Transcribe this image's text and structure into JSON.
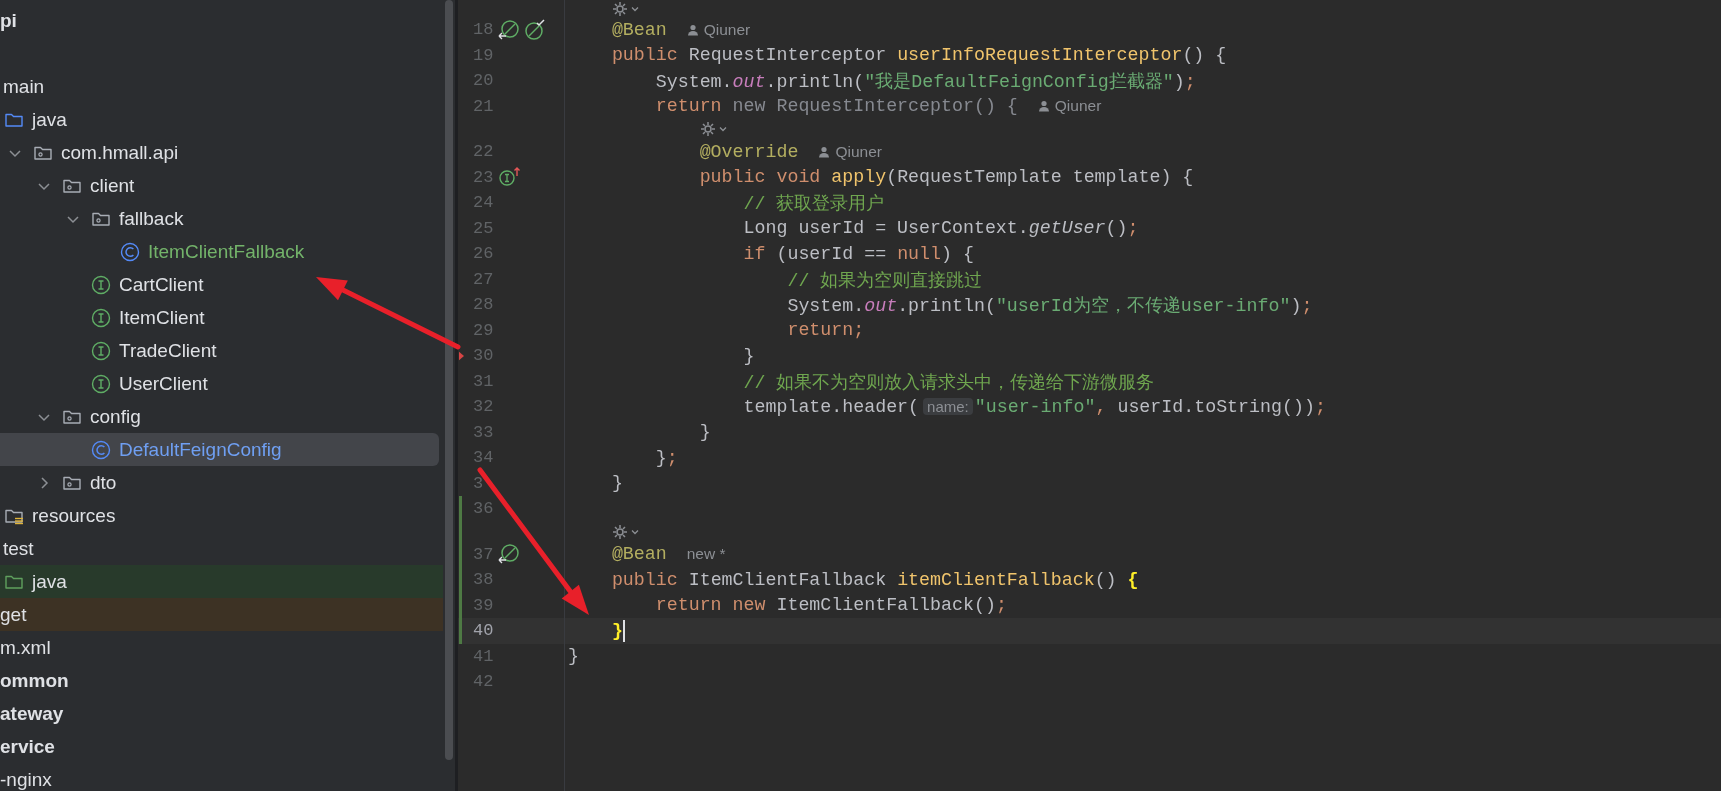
{
  "project_tree": [
    {
      "label": "pi",
      "kind": "module",
      "selected": false,
      "children": [
        {
          "children": [
            {
              "label": "main",
              "selected": false,
              "children": [
                {
                  "label": "java",
                  "kind": "source-folder",
                  "selected": false,
                  "children": [
                    {
                      "label": "com.hmall.api",
                      "kind": "package",
                      "expanded": true,
                      "selected": false,
                      "children": [
                        {
                          "label": "client",
                          "kind": "package",
                          "expanded": true,
                          "selected": false,
                          "children": [
                            {
                              "label": "fallback",
                              "kind": "package",
                              "expanded": true,
                              "selected": false,
                              "children": [
                                {
                                  "label": "ItemClientFallback",
                                  "kind": "class",
                                  "color": "#73b36a",
                                  "selected": false
                                }
                              ]
                            },
                            {
                              "label": "CartClient",
                              "kind": "interface",
                              "selected": false
                            },
                            {
                              "label": "ItemClient",
                              "kind": "interface",
                              "selected": false
                            },
                            {
                              "label": "TradeClient",
                              "kind": "interface",
                              "selected": false
                            },
                            {
                              "label": "UserClient",
                              "kind": "interface",
                              "selected": false
                            }
                          ]
                        },
                        {
                          "label": "config",
                          "kind": "package",
                          "expanded": true,
                          "selected": false,
                          "children": [
                            {
                              "label": "DefaultFeignConfig",
                              "kind": "class",
                              "color": "#6f9ff2",
                              "selected": true
                            }
                          ]
                        },
                        {
                          "label": "dto",
                          "kind": "package",
                          "expanded": false,
                          "selected": false
                        }
                      ]
                    }
                  ]
                },
                {
                  "label": "resources",
                  "kind": "resources-folder",
                  "selected": false
                }
              ]
            },
            {
              "label": "test",
              "selected": false,
              "children": [
                {
                  "label": "java",
                  "kind": "test-folder",
                  "selected": false
                }
              ]
            }
          ]
        },
        {
          "label": "get",
          "kind": "excluded",
          "selected": false
        },
        {
          "label": "m.xml",
          "kind": "item",
          "selected": false
        }
      ]
    },
    {
      "label": "ommon",
      "kind": "module",
      "selected": false
    },
    {
      "label": "ateway",
      "kind": "module",
      "selected": false
    },
    {
      "label": "ervice",
      "kind": "module",
      "selected": false
    },
    {
      "label": "-nginx",
      "kind": "item",
      "selected": false
    }
  ],
  "editor": {
    "rows": [
      {
        "number": "18",
        "current": false,
        "inlay": true,
        "gutter": [
          {
            "kind": "bean"
          },
          {
            "kind": "bean-check"
          }
        ],
        "author": "Qiuner",
        "tokens": [
          {
            "kind": "annotation",
            "text": "    @Bean"
          }
        ]
      },
      {
        "number": "19",
        "current": false,
        "tokens": [
          {
            "kind": "keyword",
            "text": "    public "
          },
          {
            "kind": "plain",
            "text": "RequestInterceptor "
          },
          {
            "kind": "decl",
            "text": "userInfoRequestInterceptor"
          },
          {
            "kind": "plain",
            "text": "() {"
          }
        ]
      },
      {
        "number": "20",
        "current": false,
        "tokens": [
          {
            "kind": "plain",
            "text": "        System."
          },
          {
            "kind": "field",
            "text": "out"
          },
          {
            "kind": "plain",
            "text": ".println("
          },
          {
            "kind": "string",
            "text": "\"我是DefaultFeignConfig拦截器\""
          },
          {
            "kind": "plain",
            "text": ")"
          },
          {
            "kind": "punct",
            "text": ";"
          }
        ]
      },
      {
        "number": "21",
        "current": false,
        "author": "Qiuner",
        "tokens": [
          {
            "kind": "keyword",
            "text": "        return "
          },
          {
            "kind": "muted",
            "text": "new RequestInterceptor() {"
          }
        ]
      },
      {
        "number": "22",
        "current": false,
        "inlay": true,
        "author": "Qiuner",
        "tokens": [
          {
            "kind": "annotation",
            "text": "            @Override"
          }
        ]
      },
      {
        "number": "23",
        "current": false,
        "gutter": [
          {
            "kind": "implements"
          }
        ],
        "tokens": [
          {
            "kind": "keyword",
            "text": "            public void "
          },
          {
            "kind": "decl",
            "text": "apply"
          },
          {
            "kind": "plain",
            "text": "(RequestTemplate template) {"
          }
        ]
      },
      {
        "number": "24",
        "current": false,
        "tokens": [
          {
            "kind": "comment",
            "text": "                // 获取登录用户"
          }
        ]
      },
      {
        "number": "25",
        "current": false,
        "tokens": [
          {
            "kind": "plain",
            "text": "                Long userId = UserContext."
          },
          {
            "kind": "call",
            "text": "getUser"
          },
          {
            "kind": "plain",
            "text": "()"
          },
          {
            "kind": "punct",
            "text": ";"
          }
        ]
      },
      {
        "number": "26",
        "current": false,
        "tokens": [
          {
            "kind": "keyword",
            "text": "                if "
          },
          {
            "kind": "plain",
            "text": "(userId == "
          },
          {
            "kind": "keyword",
            "text": "null"
          },
          {
            "kind": "plain",
            "text": ") {"
          }
        ]
      },
      {
        "number": "27",
        "current": false,
        "tokens": [
          {
            "kind": "comment",
            "text": "                    // 如果为空则直接跳过"
          }
        ]
      },
      {
        "number": "28",
        "current": false,
        "tokens": [
          {
            "kind": "plain",
            "text": "                    System."
          },
          {
            "kind": "field",
            "text": "out"
          },
          {
            "kind": "plain",
            "text": ".println("
          },
          {
            "kind": "string",
            "text": "\"userId为空，不传递user-info\""
          },
          {
            "kind": "plain",
            "text": ")"
          },
          {
            "kind": "punct",
            "text": ";"
          }
        ]
      },
      {
        "number": "29",
        "current": false,
        "tokens": [
          {
            "kind": "keyword",
            "text": "                    return"
          },
          {
            "kind": "punct",
            "text": ";"
          }
        ]
      },
      {
        "number": "30",
        "current": false,
        "change": {
          "kind": "deleted"
        },
        "tokens": [
          {
            "kind": "plain",
            "text": "                }"
          }
        ]
      },
      {
        "number": "31",
        "current": false,
        "tokens": [
          {
            "kind": "comment",
            "text": "                // 如果不为空则放入请求头中，传递给下游微服务"
          }
        ]
      },
      {
        "number": "32",
        "current": false,
        "tokens": [
          {
            "kind": "plain",
            "text": "                template.header("
          },
          {
            "kind": "hint",
            "text": "name:"
          },
          {
            "kind": "string",
            "text": "\"user-info\""
          },
          {
            "kind": "punct",
            "text": ","
          },
          {
            "kind": "plain",
            "text": " userId.toString())"
          },
          {
            "kind": "punct",
            "text": ";"
          }
        ]
      },
      {
        "number": "33",
        "current": false,
        "tokens": [
          {
            "kind": "plain",
            "text": "            }"
          }
        ]
      },
      {
        "number": "34",
        "current": false,
        "tokens": [
          {
            "kind": "plain",
            "text": "        }"
          },
          {
            "kind": "punct",
            "text": ";"
          }
        ]
      },
      {
        "number": "3",
        "current": false,
        "tokens": [
          {
            "kind": "plain",
            "text": "    }"
          }
        ]
      },
      {
        "number": "36",
        "current": false,
        "change": {
          "kind": "added"
        }
      },
      {
        "number": "37",
        "current": false,
        "inlay": true,
        "change": {
          "kind": "added"
        },
        "gutter": [
          {
            "kind": "bean"
          }
        ],
        "note": "new *",
        "tokens": [
          {
            "kind": "annotation",
            "text": "    @Bean"
          }
        ]
      },
      {
        "number": "38",
        "current": false,
        "change": {
          "kind": "added"
        },
        "tokens": [
          {
            "kind": "keyword",
            "text": "    public "
          },
          {
            "kind": "plain",
            "text": "ItemClientFallback "
          },
          {
            "kind": "decl",
            "text": "itemClientFallback"
          },
          {
            "kind": "plain",
            "text": "() "
          },
          {
            "kind": "brace",
            "text": "{"
          }
        ]
      },
      {
        "number": "39",
        "current": false,
        "change": {
          "kind": "added"
        },
        "tokens": [
          {
            "kind": "keyword",
            "text": "        return new "
          },
          {
            "kind": "plain",
            "text": "ItemClientFallback()"
          },
          {
            "kind": "punct",
            "text": ";"
          }
        ]
      },
      {
        "number": "40",
        "current": true,
        "change": {
          "kind": "added"
        },
        "tokens": [
          {
            "kind": "brace",
            "text": "    }"
          }
        ]
      },
      {
        "number": "41",
        "current": false,
        "tokens": [
          {
            "kind": "plain",
            "text": "}"
          }
        ]
      },
      {
        "number": "42",
        "current": false
      }
    ]
  }
}
